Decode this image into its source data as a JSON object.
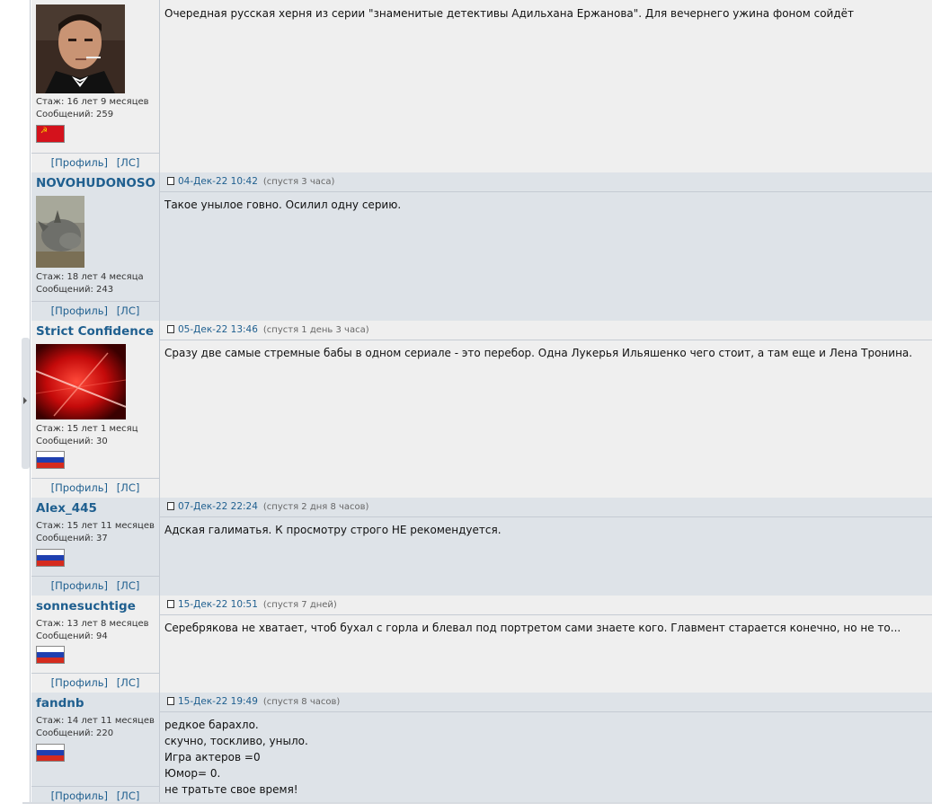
{
  "posts": [
    {
      "nick": "",
      "stage": "Стаж: 16 лет 9 месяцев",
      "messages": "Сообщений: 259",
      "flag": "ussr",
      "profile_label": "[Профиль]",
      "pm_label": "[ЛС]",
      "date": "",
      "ago": "",
      "lines": [
        "Очередная русская херня из серии \"знаменитые детективы Адильхана Ержанова\". Для вечернего ужина фоном сойдёт"
      ]
    },
    {
      "nick": "NOVOHUDONOSO",
      "stage": "Стаж: 18 лет 4 месяца",
      "messages": "Сообщений: 243",
      "flag": "",
      "profile_label": "[Профиль]",
      "pm_label": "[ЛС]",
      "date": "04-Дек-22 10:42",
      "ago": "(спустя 3 часа)",
      "lines": [
        "Такое унылое говно. Осилил одну серию."
      ]
    },
    {
      "nick": "Strict Confidence",
      "stage": "Стаж: 15 лет 1 месяц",
      "messages": "Сообщений: 30",
      "flag": "russia",
      "profile_label": "[Профиль]",
      "pm_label": "[ЛС]",
      "date": "05-Дек-22 13:46",
      "ago": "(спустя 1 день 3 часа)",
      "lines": [
        "Сразу две самые стремные бабы в одном сериале - это перебор. Одна Лукерья Ильяшенко чего стоит, а там еще и Лена Тронина."
      ]
    },
    {
      "nick": "Alex_445",
      "stage": "Стаж: 15 лет 11 месяцев",
      "messages": "Сообщений: 37",
      "flag": "russia",
      "profile_label": "[Профиль]",
      "pm_label": "[ЛС]",
      "date": "07-Дек-22 22:24",
      "ago": "(спустя 2 дня 8 часов)",
      "lines": [
        "Адская галиматья. К просмотру строго НЕ рекомендуется."
      ]
    },
    {
      "nick": "sonnesuchtige",
      "stage": "Стаж: 13 лет 8 месяцев",
      "messages": "Сообщений: 94",
      "flag": "russia",
      "profile_label": "[Профиль]",
      "pm_label": "[ЛС]",
      "date": "15-Дек-22 10:51",
      "ago": "(спустя 7 дней)",
      "lines": [
        "Серебрякова не хватает, чтоб бухал с горла и блевал под портретом сами знаете кого. Главмент старается конечно, но не то..."
      ]
    },
    {
      "nick": "fandnb",
      "stage": "Стаж: 14 лет 11 месяцев",
      "messages": "Сообщений: 220",
      "flag": "russia",
      "profile_label": "[Профиль]",
      "pm_label": "[ЛС]",
      "date": "15-Дек-22 19:49",
      "ago": "(спустя 8 часов)",
      "lines": [
        "редкое барахло.",
        "скучно, тоскливо, уныло.",
        "Игра актеров =0",
        "Юмор= 0.",
        "не тратьте свое время!"
      ]
    }
  ]
}
